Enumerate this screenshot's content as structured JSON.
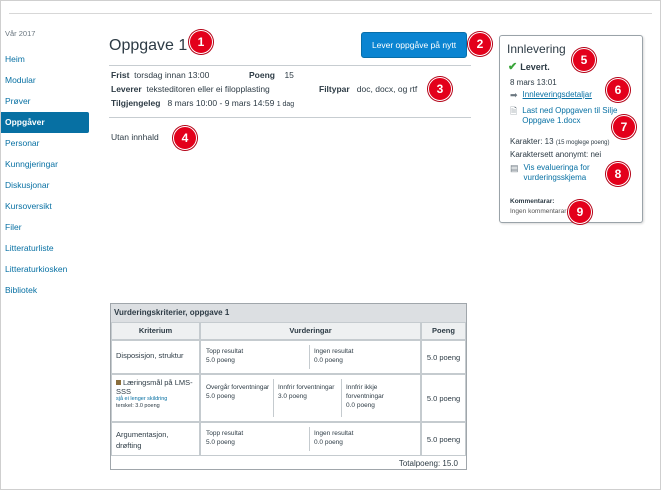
{
  "sidebar": {
    "term": "Vår 2017",
    "items": [
      {
        "label": "Heim"
      },
      {
        "label": "Modular"
      },
      {
        "label": "Prøver"
      },
      {
        "label": "Oppgåver",
        "active": true
      },
      {
        "label": "Personar"
      },
      {
        "label": "Kunngjeringar"
      },
      {
        "label": "Diskusjonar"
      },
      {
        "label": "Kursoversikt"
      },
      {
        "label": "Filer"
      },
      {
        "label": "Litteraturliste"
      },
      {
        "label": "Litteraturkiosken"
      },
      {
        "label": "Bibliotek"
      }
    ]
  },
  "assignment": {
    "title": "Oppgave 1",
    "submit_button": "Lever oppgåve på nytt",
    "due_label": "Frist",
    "due_value": "torsdag innan 13:00",
    "points_label": "Poeng",
    "points_value": "15",
    "submit_label": "Leverer",
    "submit_value": "teksteditoren eller ei filopplasting",
    "filetypes_label": "Filtypar",
    "filetypes_value": "doc, docx, og rtf",
    "available_label": "Tilgjengeleg",
    "available_value": "8 mars 10:00 - 9 mars 14:59",
    "available_duration": "1 dag",
    "content": "Utan innhald"
  },
  "callouts": [
    "1",
    "2",
    "3",
    "4",
    "5",
    "6",
    "7",
    "8",
    "9"
  ],
  "submission": {
    "title": "Innlevering",
    "status": "Levert.",
    "date": "8 mars 13:01",
    "details_link": "Innleveringsdetaljar",
    "download_link": "Last ned Oppgaven til Silje Oppgave 1.docx",
    "grade_label": "Karakter: 13",
    "grade_note": "(15 moglege poeng)",
    "anonymous": "Karaktersett anonymt: nei",
    "evaluation_link": "Vis evalueringa for vurderingsskjema",
    "comments_heading": "Kommentarar:",
    "comments_value": "Ingen kommentarar"
  },
  "rubric": {
    "title": "Vurderingskriterier, oppgave 1",
    "headers": [
      "Kriterium",
      "Vurderingar",
      "Poeng"
    ],
    "rows": [
      {
        "criterion": "Disposisjon, struktur",
        "ratings": [
          {
            "label": "Topp resultat",
            "points": "5.0 poeng"
          },
          {
            "label": "Ingen resultat",
            "points": "0.0 poeng"
          }
        ],
        "points": "5.0 poeng"
      },
      {
        "criterion": "Læringsmål på LMS-SSS",
        "note": "sjå ei lenger skildring",
        "target": "terskel: 3.0 poeng",
        "ratings": [
          {
            "label": "Overgår forventningar",
            "points": "5.0 poeng"
          },
          {
            "label": "Innfrir forventningar",
            "points": "3.0 poeng"
          },
          {
            "label": "Innfrir ikkje forventningar",
            "points": "0.0 poeng"
          }
        ],
        "points": "5.0 poeng"
      },
      {
        "criterion": "Argumentasjon, drøfting",
        "ratings": [
          {
            "label": "Topp resultat",
            "points": "5.0 poeng"
          },
          {
            "label": "Ingen resultat",
            "points": "0.0 poeng"
          }
        ],
        "points": "5.0 poeng"
      }
    ],
    "total": "Totalpoeng: 15.0"
  },
  "colors": {
    "accent": "#0770a3",
    "button": "#0a84d1",
    "badge": "#e3001b",
    "success": "#3aa53a"
  },
  "icons": [
    "checkmark-icon",
    "arrow-right-icon",
    "document-icon",
    "rubric-icon",
    "outcome-icon"
  ]
}
